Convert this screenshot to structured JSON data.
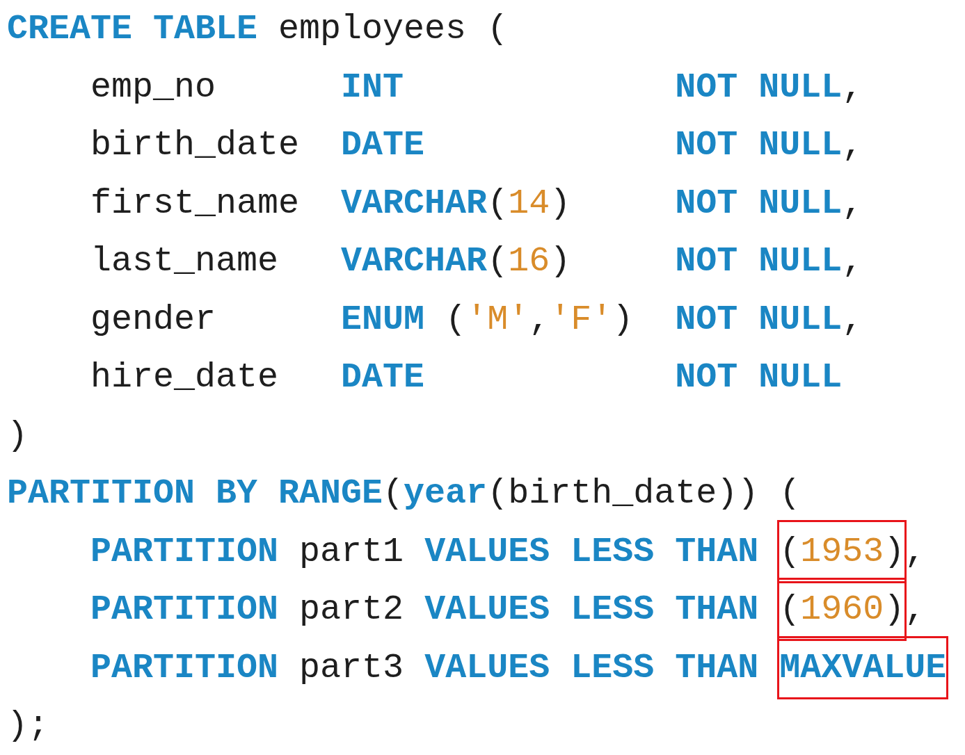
{
  "code_lines": [
    {
      "tokens": [
        {
          "text": "CREATE TABLE",
          "kind": "keyword"
        },
        {
          "text": " employees (",
          "kind": "ident"
        }
      ]
    },
    {
      "tokens": [
        {
          "text": "    emp_no      ",
          "kind": "ident"
        },
        {
          "text": "INT             ",
          "kind": "keyword"
        },
        {
          "text": "NOT NULL",
          "kind": "keyword"
        },
        {
          "text": ",",
          "kind": "punct"
        }
      ]
    },
    {
      "tokens": [
        {
          "text": "    birth_date  ",
          "kind": "ident"
        },
        {
          "text": "DATE            ",
          "kind": "keyword"
        },
        {
          "text": "NOT NULL",
          "kind": "keyword"
        },
        {
          "text": ",",
          "kind": "punct"
        }
      ]
    },
    {
      "tokens": [
        {
          "text": "    first_name  ",
          "kind": "ident"
        },
        {
          "text": "VARCHAR",
          "kind": "keyword"
        },
        {
          "text": "(",
          "kind": "punct"
        },
        {
          "text": "14",
          "kind": "number"
        },
        {
          "text": ")     ",
          "kind": "punct"
        },
        {
          "text": "NOT NULL",
          "kind": "keyword"
        },
        {
          "text": ",",
          "kind": "punct"
        }
      ]
    },
    {
      "tokens": [
        {
          "text": "    last_name   ",
          "kind": "ident"
        },
        {
          "text": "VARCHAR",
          "kind": "keyword"
        },
        {
          "text": "(",
          "kind": "punct"
        },
        {
          "text": "16",
          "kind": "number"
        },
        {
          "text": ")     ",
          "kind": "punct"
        },
        {
          "text": "NOT NULL",
          "kind": "keyword"
        },
        {
          "text": ",",
          "kind": "punct"
        }
      ]
    },
    {
      "tokens": [
        {
          "text": "    gender      ",
          "kind": "ident"
        },
        {
          "text": "ENUM",
          "kind": "keyword"
        },
        {
          "text": " (",
          "kind": "punct"
        },
        {
          "text": "'M'",
          "kind": "string"
        },
        {
          "text": ",",
          "kind": "punct"
        },
        {
          "text": "'F'",
          "kind": "string"
        },
        {
          "text": ")  ",
          "kind": "punct"
        },
        {
          "text": "NOT NULL",
          "kind": "keyword"
        },
        {
          "text": ",",
          "kind": "punct"
        }
      ]
    },
    {
      "tokens": [
        {
          "text": "    hire_date   ",
          "kind": "ident"
        },
        {
          "text": "DATE            ",
          "kind": "keyword"
        },
        {
          "text": "NOT NULL",
          "kind": "keyword"
        }
      ]
    },
    {
      "tokens": [
        {
          "text": ")",
          "kind": "punct"
        }
      ]
    },
    {
      "tokens": [
        {
          "text": "PARTITION BY RANGE",
          "kind": "keyword"
        },
        {
          "text": "(",
          "kind": "punct"
        },
        {
          "text": "year",
          "kind": "keyword"
        },
        {
          "text": "(birth_date)) (",
          "kind": "ident"
        }
      ]
    },
    {
      "tokens": [
        {
          "text": "    PARTITION",
          "kind": "keyword"
        },
        {
          "text": " part1 ",
          "kind": "ident"
        },
        {
          "text": "VALUES LESS THAN ",
          "kind": "keyword"
        },
        {
          "kind": "marked",
          "tokens": [
            {
              "text": "(",
              "kind": "punct"
            },
            {
              "text": "1953",
              "kind": "number"
            },
            {
              "text": ")",
              "kind": "punct"
            }
          ]
        },
        {
          "text": ",",
          "kind": "punct"
        }
      ]
    },
    {
      "tokens": [
        {
          "text": "    PARTITION",
          "kind": "keyword"
        },
        {
          "text": " part2 ",
          "kind": "ident"
        },
        {
          "text": "VALUES LESS THAN ",
          "kind": "keyword"
        },
        {
          "kind": "marked",
          "tokens": [
            {
              "text": "(",
              "kind": "punct"
            },
            {
              "text": "1960",
              "kind": "number"
            },
            {
              "text": ")",
              "kind": "punct"
            }
          ]
        },
        {
          "text": ",",
          "kind": "punct"
        }
      ]
    },
    {
      "tokens": [
        {
          "text": "    PARTITION",
          "kind": "keyword"
        },
        {
          "text": " part3 ",
          "kind": "ident"
        },
        {
          "text": "VALUES LESS THAN ",
          "kind": "keyword"
        },
        {
          "kind": "marked",
          "tokens": [
            {
              "text": "MAXVALUE",
              "kind": "keyword"
            }
          ]
        }
      ]
    },
    {
      "tokens": [
        {
          "text": ");",
          "kind": "punct"
        }
      ]
    }
  ]
}
